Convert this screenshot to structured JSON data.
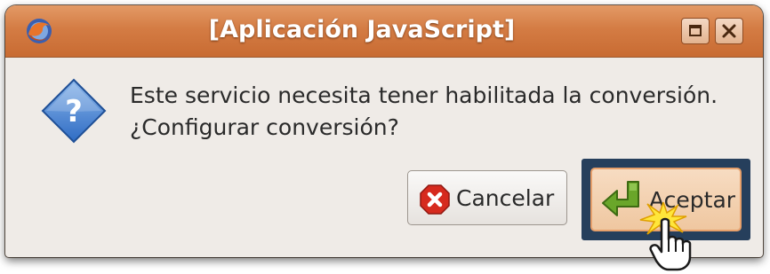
{
  "window": {
    "title": "[Aplicación JavaScript]",
    "app_icon": "firefox-icon",
    "controls": [
      "maximize-icon",
      "close-icon"
    ]
  },
  "dialog": {
    "icon": "question-icon",
    "message_line1": "Este servicio necesita tener habilitada la conversión.",
    "message_line2": "¿Configurar conversión?"
  },
  "buttons": {
    "cancel_label": "Cancelar",
    "cancel_icon": "cancel-x-icon",
    "accept_label": "Aceptar",
    "accept_icon": "return-arrow-icon"
  },
  "colors": {
    "titlebar": "#d47c44",
    "dialog_bg": "#efebe7",
    "highlight_frame": "#263f5c",
    "accept_bg": "#efc7a0",
    "cancel_icon_red": "#d62a1e",
    "accept_icon_green": "#6aa62a"
  },
  "cursor": "hand-pointer-icon"
}
